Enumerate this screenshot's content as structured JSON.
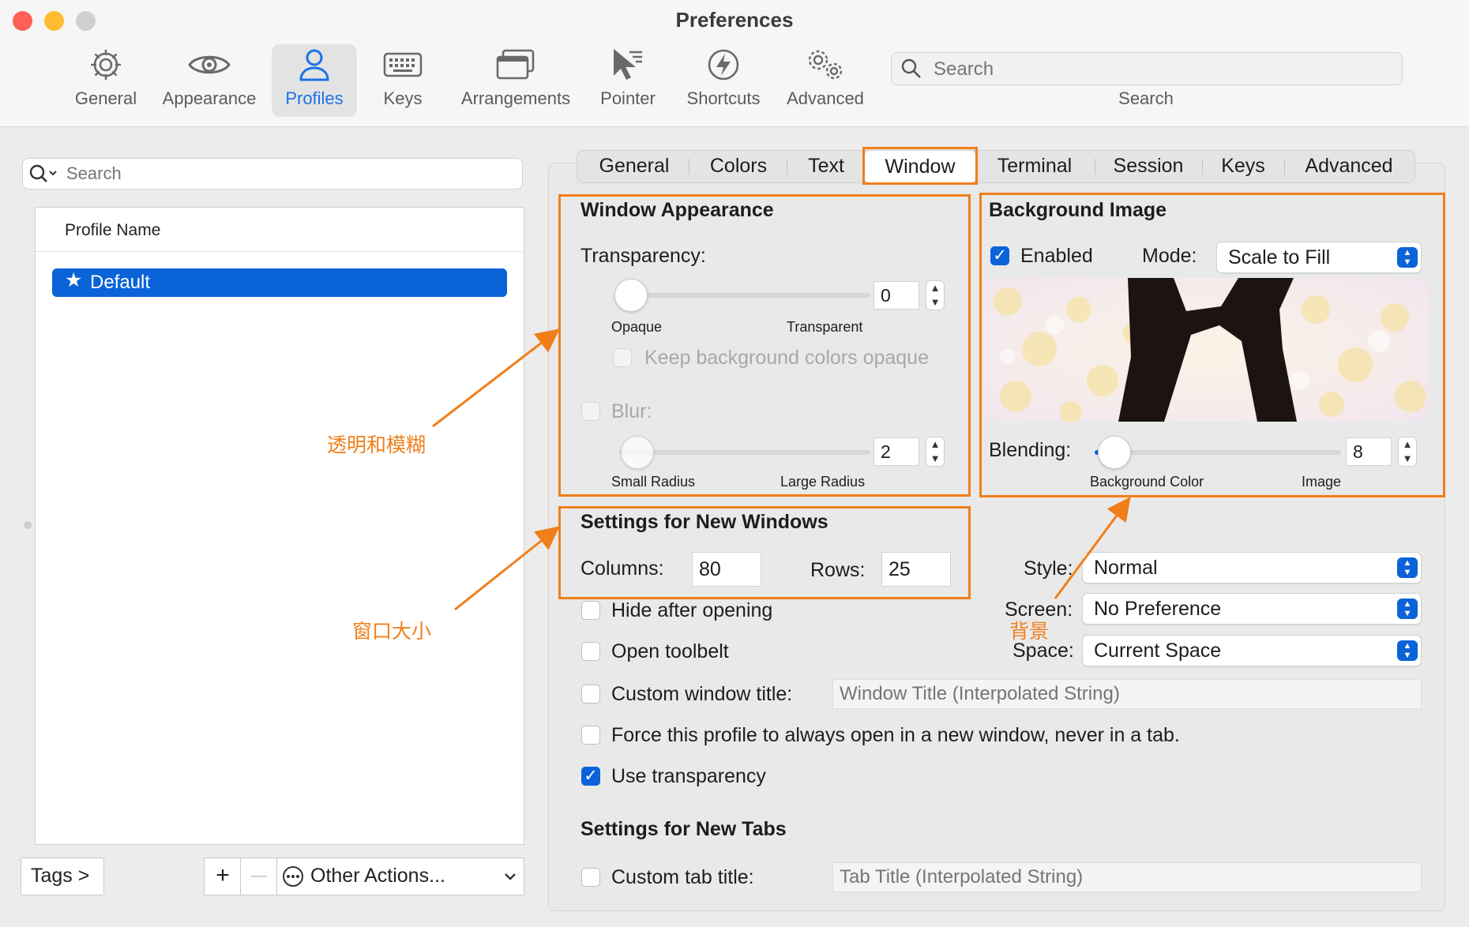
{
  "window": {
    "title": "Preferences"
  },
  "toolbar": {
    "items": [
      {
        "label": "General",
        "icon": "gear-icon"
      },
      {
        "label": "Appearance",
        "icon": "eye-icon"
      },
      {
        "label": "Profiles",
        "icon": "person-icon"
      },
      {
        "label": "Keys",
        "icon": "keyboard-icon"
      },
      {
        "label": "Arrangements",
        "icon": "window-stack-icon"
      },
      {
        "label": "Pointer",
        "icon": "pointer-icon"
      },
      {
        "label": "Shortcuts",
        "icon": "lightning-icon"
      },
      {
        "label": "Advanced",
        "icon": "gears-icon"
      }
    ],
    "active": "Profiles",
    "search_placeholder": "Search",
    "search_caption": "Search"
  },
  "profiles_panel": {
    "search_placeholder": "Search",
    "header": "Profile Name",
    "profiles": [
      "Default"
    ],
    "tags_button": "Tags >",
    "add_button": "+",
    "remove_button": "—",
    "other_actions": "Other Actions..."
  },
  "tabs": [
    "General",
    "Colors",
    "Text",
    "Window",
    "Terminal",
    "Session",
    "Keys",
    "Advanced"
  ],
  "selected_tab": "Window",
  "window_appearance": {
    "title": "Window Appearance",
    "transparency_label": "Transparency:",
    "transparency_value": "0",
    "opaque_label": "Opaque",
    "transparent_label": "Transparent",
    "keep_bg_opaque": "Keep background colors opaque",
    "blur_label": "Blur:",
    "blur_value": "2",
    "small_radius": "Small Radius",
    "large_radius": "Large Radius"
  },
  "background_image": {
    "title": "Background Image",
    "enabled_label": "Enabled",
    "enabled": true,
    "mode_label": "Mode:",
    "mode_value": "Scale to Fill",
    "blending_label": "Blending:",
    "blending_value": "8",
    "bg_color_label": "Background Color",
    "image_label": "Image"
  },
  "new_windows": {
    "title": "Settings for New Windows",
    "columns_label": "Columns:",
    "columns_value": "80",
    "rows_label": "Rows:",
    "rows_value": "25",
    "style_label": "Style:",
    "style_value": "Normal",
    "screen_label": "Screen:",
    "screen_value": "No Preference",
    "space_label": "Space:",
    "space_value": "Current Space",
    "hide_after_opening": "Hide after opening",
    "open_toolbelt": "Open toolbelt",
    "custom_window_title": "Custom window title:",
    "window_title_placeholder": "Window Title (Interpolated String)",
    "force_new_window": "Force this profile to always open in a new window, never in a tab.",
    "use_transparency": "Use transparency"
  },
  "new_tabs": {
    "title": "Settings for New Tabs",
    "custom_tab_title": "Custom tab title:",
    "tab_title_placeholder": "Tab Title (Interpolated String)"
  },
  "annotations": {
    "transparency_blur": "透明和模糊",
    "window_size": "窗口大小",
    "background": "背景"
  },
  "colors": {
    "accent": "#0a63d8",
    "annotation": "#f07f1a"
  }
}
